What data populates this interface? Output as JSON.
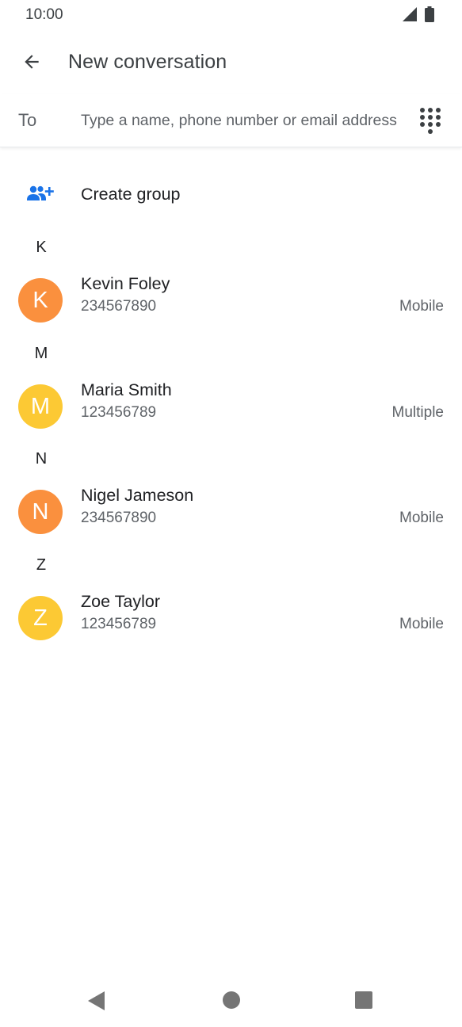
{
  "status_bar": {
    "time": "10:00"
  },
  "toolbar": {
    "title": "New conversation"
  },
  "recipient": {
    "to_label": "To",
    "placeholder": "Type a name, phone number or email address",
    "value": ""
  },
  "create_group": {
    "label": "Create group"
  },
  "sections": [
    {
      "letter": "K",
      "contacts": [
        {
          "initial": "K",
          "name": "Kevin Foley",
          "number": "234567890",
          "type": "Mobile",
          "color": "#fa903e"
        }
      ]
    },
    {
      "letter": "M",
      "contacts": [
        {
          "initial": "M",
          "name": "Maria Smith",
          "number": "123456789",
          "type": "Multiple",
          "color": "#fcc934"
        }
      ]
    },
    {
      "letter": "N",
      "contacts": [
        {
          "initial": "N",
          "name": "Nigel Jameson",
          "number": "234567890",
          "type": "Mobile",
          "color": "#fa903e"
        }
      ]
    },
    {
      "letter": "Z",
      "contacts": [
        {
          "initial": "Z",
          "name": "Zoe Taylor",
          "number": "123456789",
          "type": "Mobile",
          "color": "#fcc934"
        }
      ]
    }
  ],
  "colors": {
    "accent": "#1a73e8",
    "orange_avatar": "#fa903e",
    "yellow_avatar": "#fcc934"
  },
  "icons": {
    "back": "arrow-back-icon",
    "dialpad": "dialpad-icon",
    "group_add": "group-add-icon",
    "signal": "cell-signal-icon",
    "battery": "battery-icon"
  }
}
